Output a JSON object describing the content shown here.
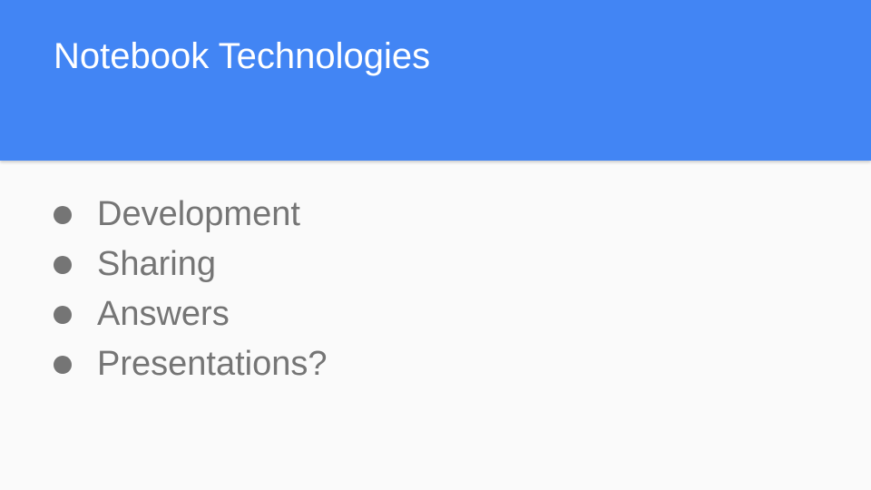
{
  "slide": {
    "title": "Notebook Technologies",
    "bullets": [
      "Development",
      "Sharing",
      "Answers",
      "Presentations?"
    ]
  },
  "colors": {
    "header_background": "#4285f4",
    "title_text": "#ffffff",
    "body_background": "#fafafa",
    "bullet_text": "#757575"
  }
}
